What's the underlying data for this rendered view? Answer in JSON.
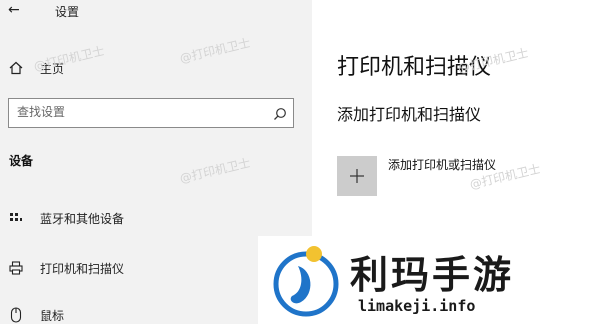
{
  "window": {
    "title": "设置"
  },
  "sidebar": {
    "home_label": "主页",
    "search_placeholder": "查找设置",
    "section_title": "设备",
    "items": [
      {
        "label": "蓝牙和其他设备",
        "icon": "keyboard-icon"
      },
      {
        "label": "打印机和扫描仪",
        "icon": "printer-icon"
      },
      {
        "label": "鼠标",
        "icon": "mouse-icon"
      }
    ]
  },
  "main": {
    "title": "打印机和扫描仪",
    "subtitle": "添加打印机和扫描仪",
    "add_label": "添加打印机或扫描仪"
  },
  "watermark": {
    "text": "@打印机卫士"
  },
  "logo": {
    "cn": "利玛手游",
    "en": "limakeji.info"
  },
  "colors": {
    "sidebar_bg": "#f2f2f2",
    "add_tile": "#cccccc",
    "logo_blue": "#1f74c9",
    "logo_yellow": "#f2c230"
  }
}
